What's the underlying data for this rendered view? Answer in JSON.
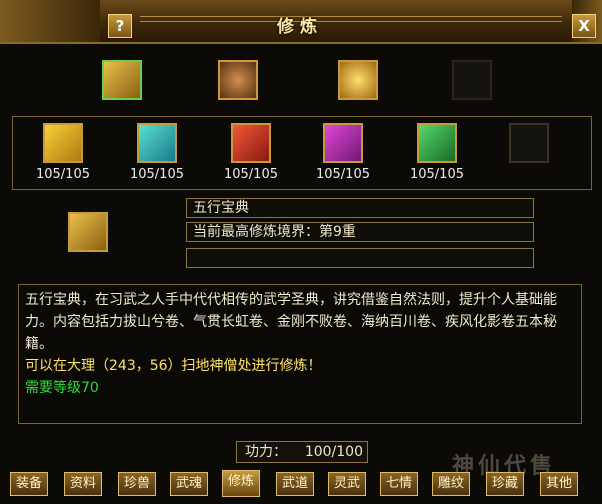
{
  "window": {
    "title": "修炼",
    "help_label": "?",
    "close_label": "X"
  },
  "top_row": [
    {
      "name": "wuxing-baodian-icon",
      "color": "#c8a030",
      "selected": true
    },
    {
      "name": "treasure-scroll-icon",
      "color": "#8a5a2a",
      "selected": false
    },
    {
      "name": "treasure-chest-icon",
      "color": "#d8a020",
      "selected": false
    },
    {
      "name": "empty-slot",
      "color": "#1a1812",
      "selected": false
    }
  ],
  "books": [
    {
      "name": "yellow-book-icon",
      "color": "#e2b21e",
      "count": "105/105"
    },
    {
      "name": "teal-book-icon",
      "color": "#2bb0a8",
      "count": "105/105"
    },
    {
      "name": "red-book-icon",
      "color": "#d0301e",
      "count": "105/105"
    },
    {
      "name": "purple-book-icon",
      "color": "#b02aa8",
      "count": "105/105"
    },
    {
      "name": "green-book-icon",
      "color": "#2a9a3a",
      "count": "105/105"
    },
    {
      "name": "empty-slot",
      "color": "#1a1812",
      "count": ""
    }
  ],
  "detail": {
    "name": "五行宝典",
    "level": "当前最高修炼境界：第9重",
    "extra": ""
  },
  "description": {
    "main": "五行宝典，在习武之人手中代代相传的武学圣典，讲究借鉴自然法则，提升个人基础能力。内容包括力拔山兮卷、气贯长虹卷、金刚不败卷、海纳百川卷、疾风化影卷五本秘籍。",
    "location": "可以在大理（243，56）扫地神僧处进行修炼！",
    "requirement": "需要等级70"
  },
  "power": {
    "label": "功力：",
    "value": "100/100"
  },
  "tabs": [
    "装备",
    "资料",
    "珍兽",
    "武魂",
    "修炼",
    "武道",
    "灵武",
    "七情",
    "雕纹",
    "珍藏",
    "其他"
  ],
  "active_tab": "修炼",
  "watermark": "神仙代售"
}
